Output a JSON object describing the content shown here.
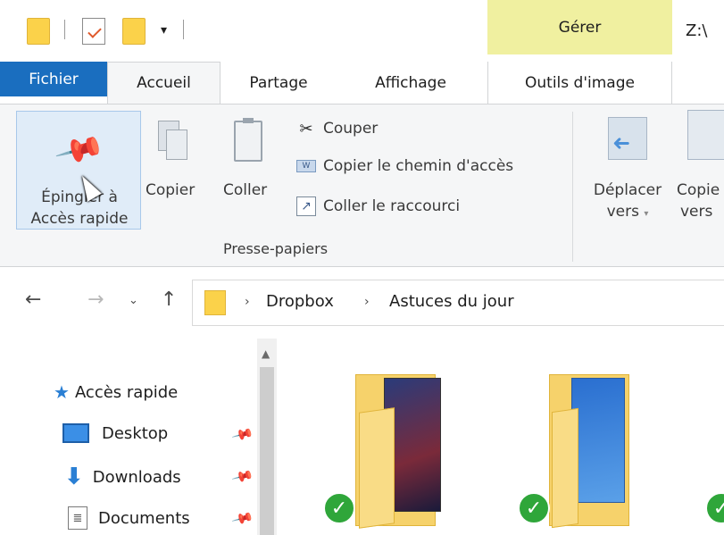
{
  "titlebar": {
    "manage_tab": "Gérer",
    "path_title": "Z:\\"
  },
  "tabs": {
    "fichier": "Fichier",
    "accueil": "Accueil",
    "partage": "Partage",
    "affichage": "Affichage",
    "outils_image": "Outils d'image"
  },
  "ribbon": {
    "pin_line1": "Épingler à",
    "pin_line2": "Accès rapide",
    "copy": "Copier",
    "paste": "Coller",
    "cut": "Couper",
    "copy_path": "Copier le chemin d'accès",
    "paste_shortcut": "Coller le raccourci",
    "clipboard_group": "Presse-papiers",
    "move_line1": "Déplacer",
    "move_line2": "vers",
    "copyto_line1": "Copie",
    "copyto_line2": "vers"
  },
  "address": {
    "crumbs": [
      "Dropbox",
      "Astuces du jour"
    ]
  },
  "navpane": {
    "items": [
      {
        "label": "Accès rapide",
        "icon": "star-icon"
      },
      {
        "label": "Desktop",
        "icon": "desktop-icon",
        "pinned": true
      },
      {
        "label": "Downloads",
        "icon": "download-icon",
        "pinned": true
      },
      {
        "label": "Documents",
        "icon": "documents-icon",
        "pinned": true
      }
    ]
  },
  "content": {
    "folders": [
      {
        "label": "",
        "status": "synced"
      },
      {
        "label": "",
        "status": "synced"
      },
      {
        "label": "",
        "status": "synced"
      }
    ]
  },
  "colors": {
    "accent": "#1a6ebf",
    "manage_tab": "#f0f0a0",
    "folder": "#fbd24a",
    "synced": "#2fa63a"
  }
}
